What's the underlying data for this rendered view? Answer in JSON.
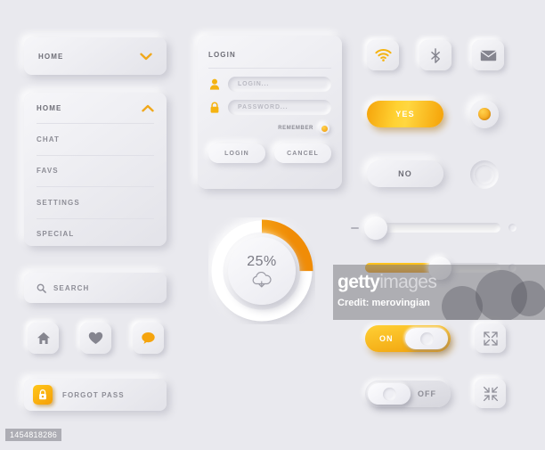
{
  "background": "#e9e9ee",
  "accent": "#f5a30a",
  "accent_light": "#ffd740",
  "dropdown_collapsed": {
    "label": "HOME",
    "chevron": "chevron-down-icon"
  },
  "dropdown_expanded": {
    "items": [
      {
        "label": "HOME",
        "chevron": "chevron-up-icon"
      },
      {
        "label": "CHAT"
      },
      {
        "label": "FAVS"
      },
      {
        "label": "SETTINGS"
      },
      {
        "label": "SPECIAL"
      }
    ]
  },
  "search": {
    "placeholder": "SEARCH",
    "icon": "search-icon"
  },
  "icon_buttons": [
    {
      "name": "home-icon",
      "label": "home"
    },
    {
      "name": "heart-icon",
      "label": "favorite"
    },
    {
      "name": "chat-bubble-icon",
      "label": "chat"
    }
  ],
  "forgot_pass": {
    "label": "FORGOT PASS",
    "icon": "lock-icon"
  },
  "login_panel": {
    "title": "LOGIN",
    "username": {
      "placeholder": "LOGIN...",
      "icon": "user-icon",
      "value": ""
    },
    "password": {
      "placeholder": "PASSWORD...",
      "icon": "lock-icon",
      "value": ""
    },
    "remember": {
      "label": "REMEMBER",
      "checked": true
    },
    "submit_label": "LOGIN",
    "cancel_label": "CANCEL"
  },
  "status_icons": [
    {
      "name": "wifi-icon",
      "label": "Wi-Fi",
      "color": "#f5a30a"
    },
    {
      "name": "bluetooth-icon",
      "label": "Bluetooth",
      "color": "#8d8d96"
    },
    {
      "name": "envelope-icon",
      "label": "Mail",
      "color": "#8d8d96"
    }
  ],
  "confirm": {
    "yes_label": "YES",
    "no_label": "NO"
  },
  "radios": [
    {
      "name": "radio-selected",
      "checked": true
    },
    {
      "name": "radio-unselected",
      "checked": false
    }
  ],
  "progress": {
    "value_label": "25%",
    "percent": 25,
    "icon": "cloud-download-icon"
  },
  "sliders": [
    {
      "name": "slider-volume",
      "percent": 8,
      "minus_icon": "minus-icon",
      "filled": false
    },
    {
      "name": "slider-brightness",
      "percent": 55,
      "filled": true
    }
  ],
  "toggles": [
    {
      "name": "toggle-gray-off",
      "state": "right",
      "color": "#c6c6cd"
    },
    {
      "name": "toggle-yellow-on",
      "state": "left",
      "color": "#f0a10b"
    }
  ],
  "onoff_toggles": [
    {
      "name": "toggle-on",
      "label": "ON",
      "state": "on"
    },
    {
      "name": "toggle-off",
      "label": "OFF",
      "state": "off"
    }
  ],
  "window_icons": [
    {
      "name": "expand-icon",
      "label": "expand"
    },
    {
      "name": "collapse-icon",
      "label": "collapse"
    }
  ],
  "watermark": {
    "logo_bold": "getty",
    "logo_light": "images",
    "credit": "Credit: merovingian"
  },
  "image_id": "1454818286"
}
